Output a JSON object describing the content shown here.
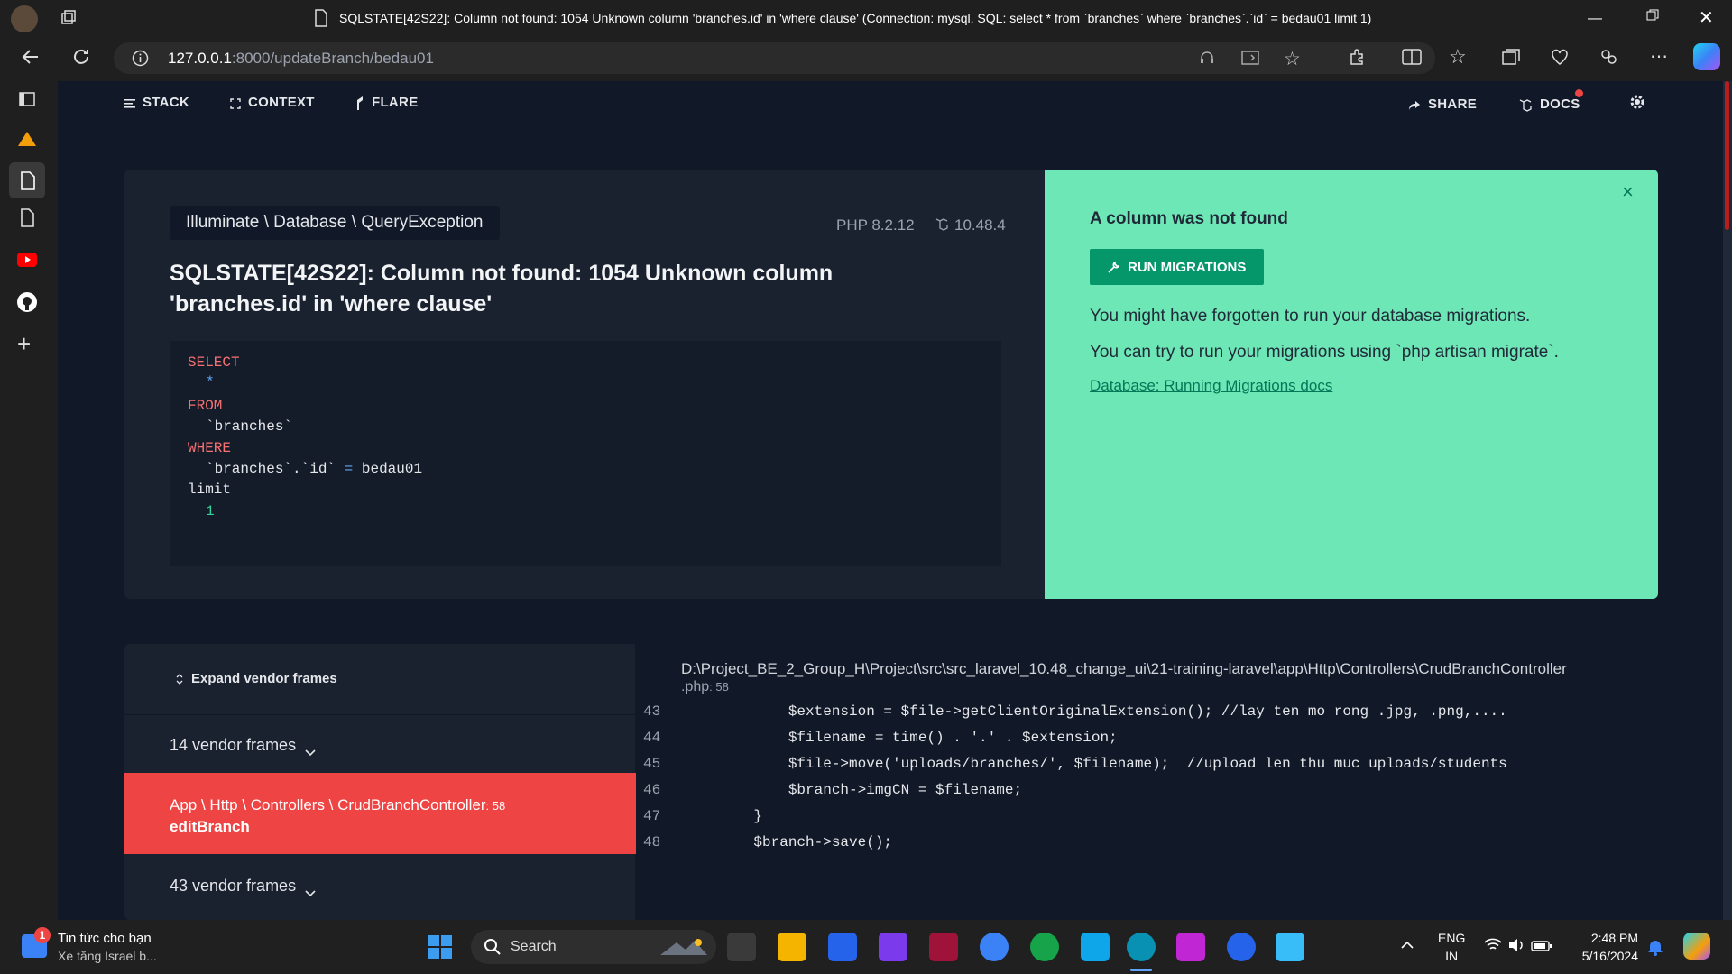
{
  "browser": {
    "title": "SQLSTATE[42S22]: Column not found: 1054 Unknown column 'branches.id' in 'where clause' (Connection: mysql, SQL: select * from `branches` where `branches`.`id` = bedau01 limit 1)",
    "url_host": "127.0.0.1",
    "url_path": ":8000/updateBranch/bedau01"
  },
  "nav": {
    "stack": "STACK",
    "context": "CONTEXT",
    "flare": "FLARE",
    "share": "SHARE",
    "docs": "DOCS"
  },
  "exception": {
    "class": "Illuminate \\ Database \\ QueryException",
    "php_version": "PHP 8.2.12",
    "laravel_version": "10.48.4",
    "message": "SQLSTATE[42S22]: Column not found: 1054 Unknown column 'branches.id' in 'where clause'",
    "sql": {
      "select": "SELECT",
      "star": "*",
      "from": "FROM",
      "table": "`branches`",
      "where": "WHERE",
      "cond_col": "`branches`.`id`",
      "cond_op": "=",
      "cond_val": "bedau01",
      "limit": "limit",
      "limit_val": "1"
    }
  },
  "solution": {
    "title": "A column was not found",
    "button": "RUN MIGRATIONS",
    "line1": "You might have forgotten to run your database migrations.",
    "line2": "You can try to run your migrations using `php artisan migrate`.",
    "link": "Database: Running Migrations docs",
    "close": "×"
  },
  "frames": {
    "expand": "Expand vendor frames",
    "vendor_a": "14 vendor frames",
    "app_class": "App \\ Http \\ Controllers \\ CrudBranchController",
    "app_line": ": 58",
    "app_method": "editBranch",
    "vendor_b": "43 vendor frames"
  },
  "code": {
    "path": "D:\\Project_BE_2_Group_H\\Project\\src\\src_laravel_10.48_change_ui\\21-training-laravel\\app\\Http\\Controllers\\CrudBranchController",
    "ext": ".php",
    "line": ": 58",
    "lines": [
      {
        "no": "43",
        "text": "        $extension = $file->getClientOriginalExtension(); //lay ten mo rong .jpg, .png,...."
      },
      {
        "no": "44",
        "text": "        $filename = time() . '.' . $extension;"
      },
      {
        "no": "45",
        "text": "        $file->move('uploads/branches/', $filename);  //upload len thu muc uploads/students"
      },
      {
        "no": "46",
        "text": "        $branch->imgCN = $filename;"
      },
      {
        "no": "47",
        "text": "    }"
      },
      {
        "no": "48",
        "text": "    $branch->save();"
      }
    ]
  },
  "taskbar": {
    "news_title": "Tin tức cho bạn",
    "news_sub": "Xe tăng Israel b...",
    "news_badge": "1",
    "search": "Search",
    "lang1": "ENG",
    "lang2": "IN",
    "time": "2:48 PM",
    "date": "5/16/2024"
  },
  "colors": {
    "accent_red": "#ef4444",
    "solution_green": "#6ee7b7",
    "button_green": "#059669"
  }
}
